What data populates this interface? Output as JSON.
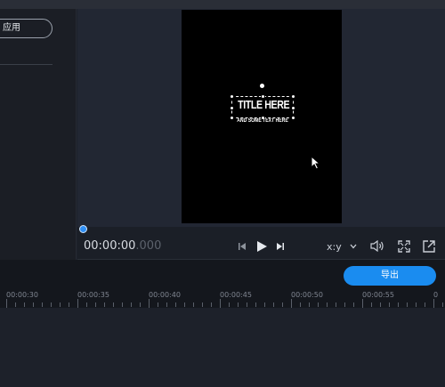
{
  "left_panel": {
    "apply_label": "应用"
  },
  "preview": {
    "title": "TITLE HERE",
    "subtitle": "AND SOME TEXT HERE"
  },
  "playback": {
    "timecode_main": "00:00:00",
    "timecode_ms": ".000",
    "aspect_label": "x:y",
    "icons": [
      "skip-back-icon",
      "play-icon",
      "skip-forward-icon",
      "chevron-down-icon",
      "volume-icon",
      "fullscreen-icon",
      "popout-icon"
    ]
  },
  "timeline": {
    "export_label": "导出",
    "ruler_labels": [
      "00:00:30",
      "00:00:35",
      "00:00:40",
      "00:00:45",
      "00:00:50",
      "00:00:55",
      "0"
    ]
  },
  "colors": {
    "accent": "#1a8cf0",
    "scrubber": "#2f8ff4",
    "panel": "#1b1e25",
    "preview_bg": "#222733"
  }
}
